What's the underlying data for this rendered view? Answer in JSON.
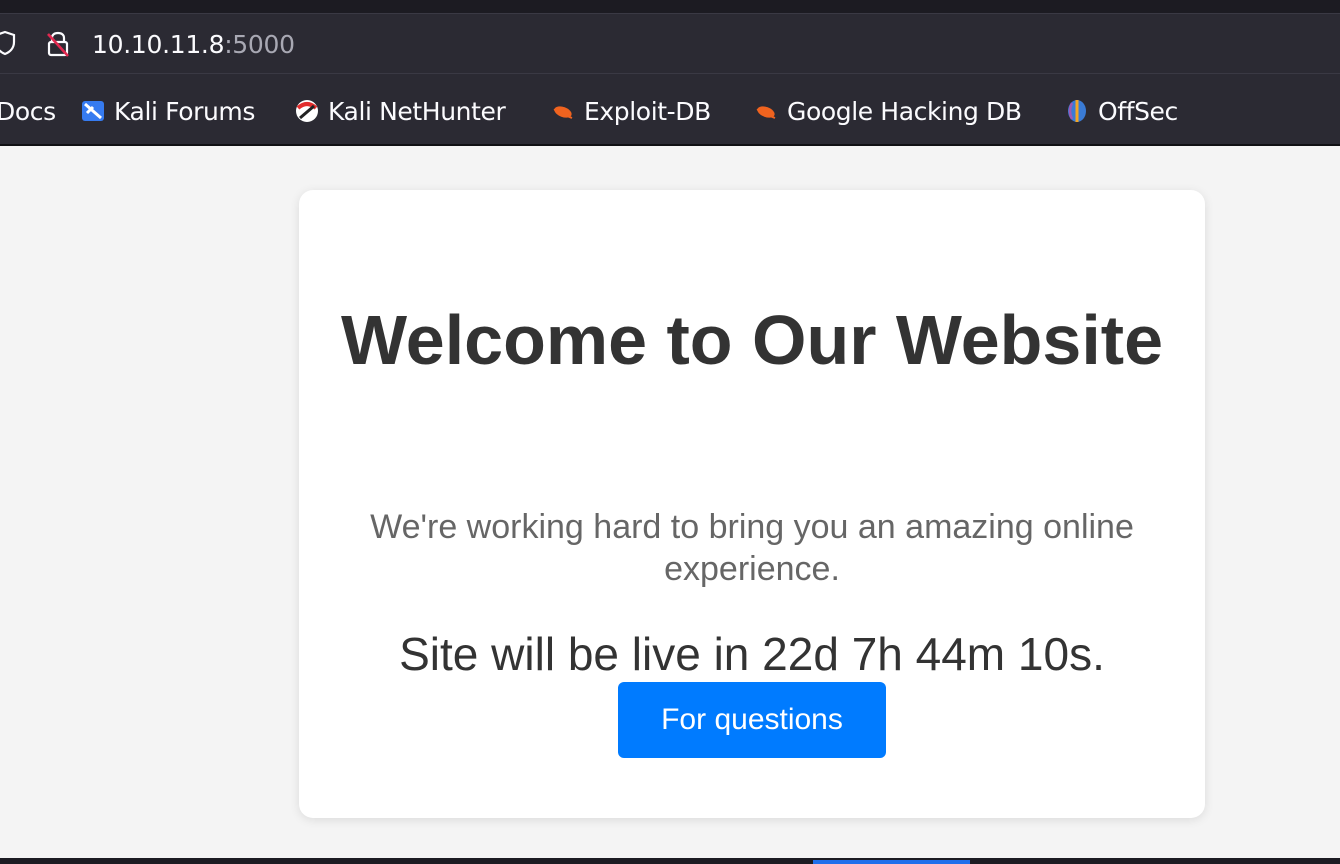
{
  "browser": {
    "url_host": "10.10.11.8",
    "url_port": ":5000",
    "icons": {
      "tracking": "shield-icon",
      "security": "lock-insecure-icon"
    }
  },
  "bookmarks": [
    {
      "label": "Docs",
      "icon": "none"
    },
    {
      "label": "Kali Forums",
      "icon": "kali-forums-icon"
    },
    {
      "label": "Kali NetHunter",
      "icon": "kali-nethunter-icon"
    },
    {
      "label": "Exploit-DB",
      "icon": "exploit-db-icon"
    },
    {
      "label": "Google Hacking DB",
      "icon": "exploit-db-icon"
    },
    {
      "label": "OffSec",
      "icon": "offsec-icon"
    }
  ],
  "page": {
    "title": "Welcome to Our Website",
    "subtitle": "We're working hard to bring you an amazing online experience.",
    "countdown": "Site will be live in 22d 7h 44m 10s.",
    "button_label": "For questions"
  },
  "colors": {
    "accent": "#007bff",
    "chrome_bg": "#2b2a33",
    "page_bg": "#f4f4f4"
  }
}
